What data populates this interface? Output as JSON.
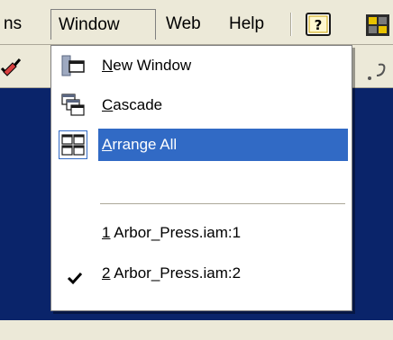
{
  "menubar": {
    "items": [
      {
        "label": "ns"
      },
      {
        "label": "Window"
      },
      {
        "label": "Web"
      },
      {
        "label": "Help"
      }
    ],
    "help_icon": "help-question-icon",
    "toolbar_icon": "toolbar-tool-icon"
  },
  "window_menu": {
    "new_window": {
      "mnemonic": "N",
      "rest": "ew Window",
      "icon": "new-window-icon"
    },
    "cascade": {
      "mnemonic": "C",
      "rest": "ascade",
      "icon": "cascade-windows-icon"
    },
    "arrange_all": {
      "mnemonic": "A",
      "rest": "rrange All",
      "icon": "arrange-all-icon"
    },
    "doc1": {
      "mnemonic": "1",
      "rest": " Arbor_Press.iam:1"
    },
    "doc2": {
      "mnemonic": "2",
      "rest": " Arbor_Press.iam:2",
      "checked": true
    }
  },
  "colors": {
    "highlight": "#316ac5",
    "workspace": "#0a246a",
    "chrome": "#ece9d8"
  }
}
